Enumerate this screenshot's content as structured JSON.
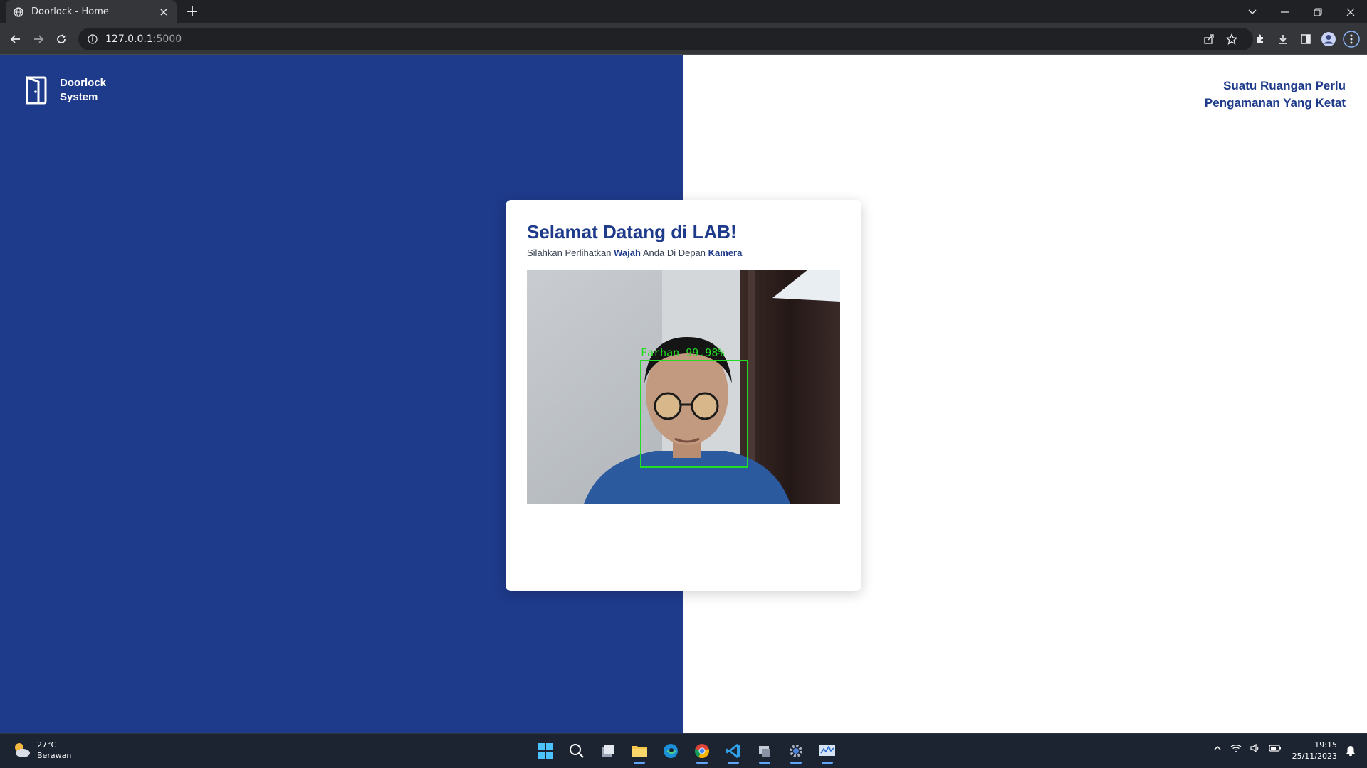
{
  "browser": {
    "tab_title": "Doorlock - Home",
    "url_host": "127.0.0.1",
    "url_port": ":5000"
  },
  "page": {
    "brand_line1": "Doorlock",
    "brand_line2": "System",
    "tagline_line1": "Suatu Ruangan Perlu",
    "tagline_line2": "Pengamanan Yang Ketat",
    "card_title": "Selamat Datang di LAB!",
    "instruction_part1": "Silahkan Perlihatkan ",
    "instruction_bold1": "Wajah",
    "instruction_part2": " Anda Di Depan ",
    "instruction_bold2": "Kamera",
    "detection_label": "Farhan 99.98%"
  },
  "taskbar": {
    "temperature": "27°C",
    "weather": "Berawan",
    "time": "19:15",
    "date": "25/11/2023"
  },
  "colors": {
    "primary": "#1e3a8a",
    "detection": "#22dd22"
  }
}
